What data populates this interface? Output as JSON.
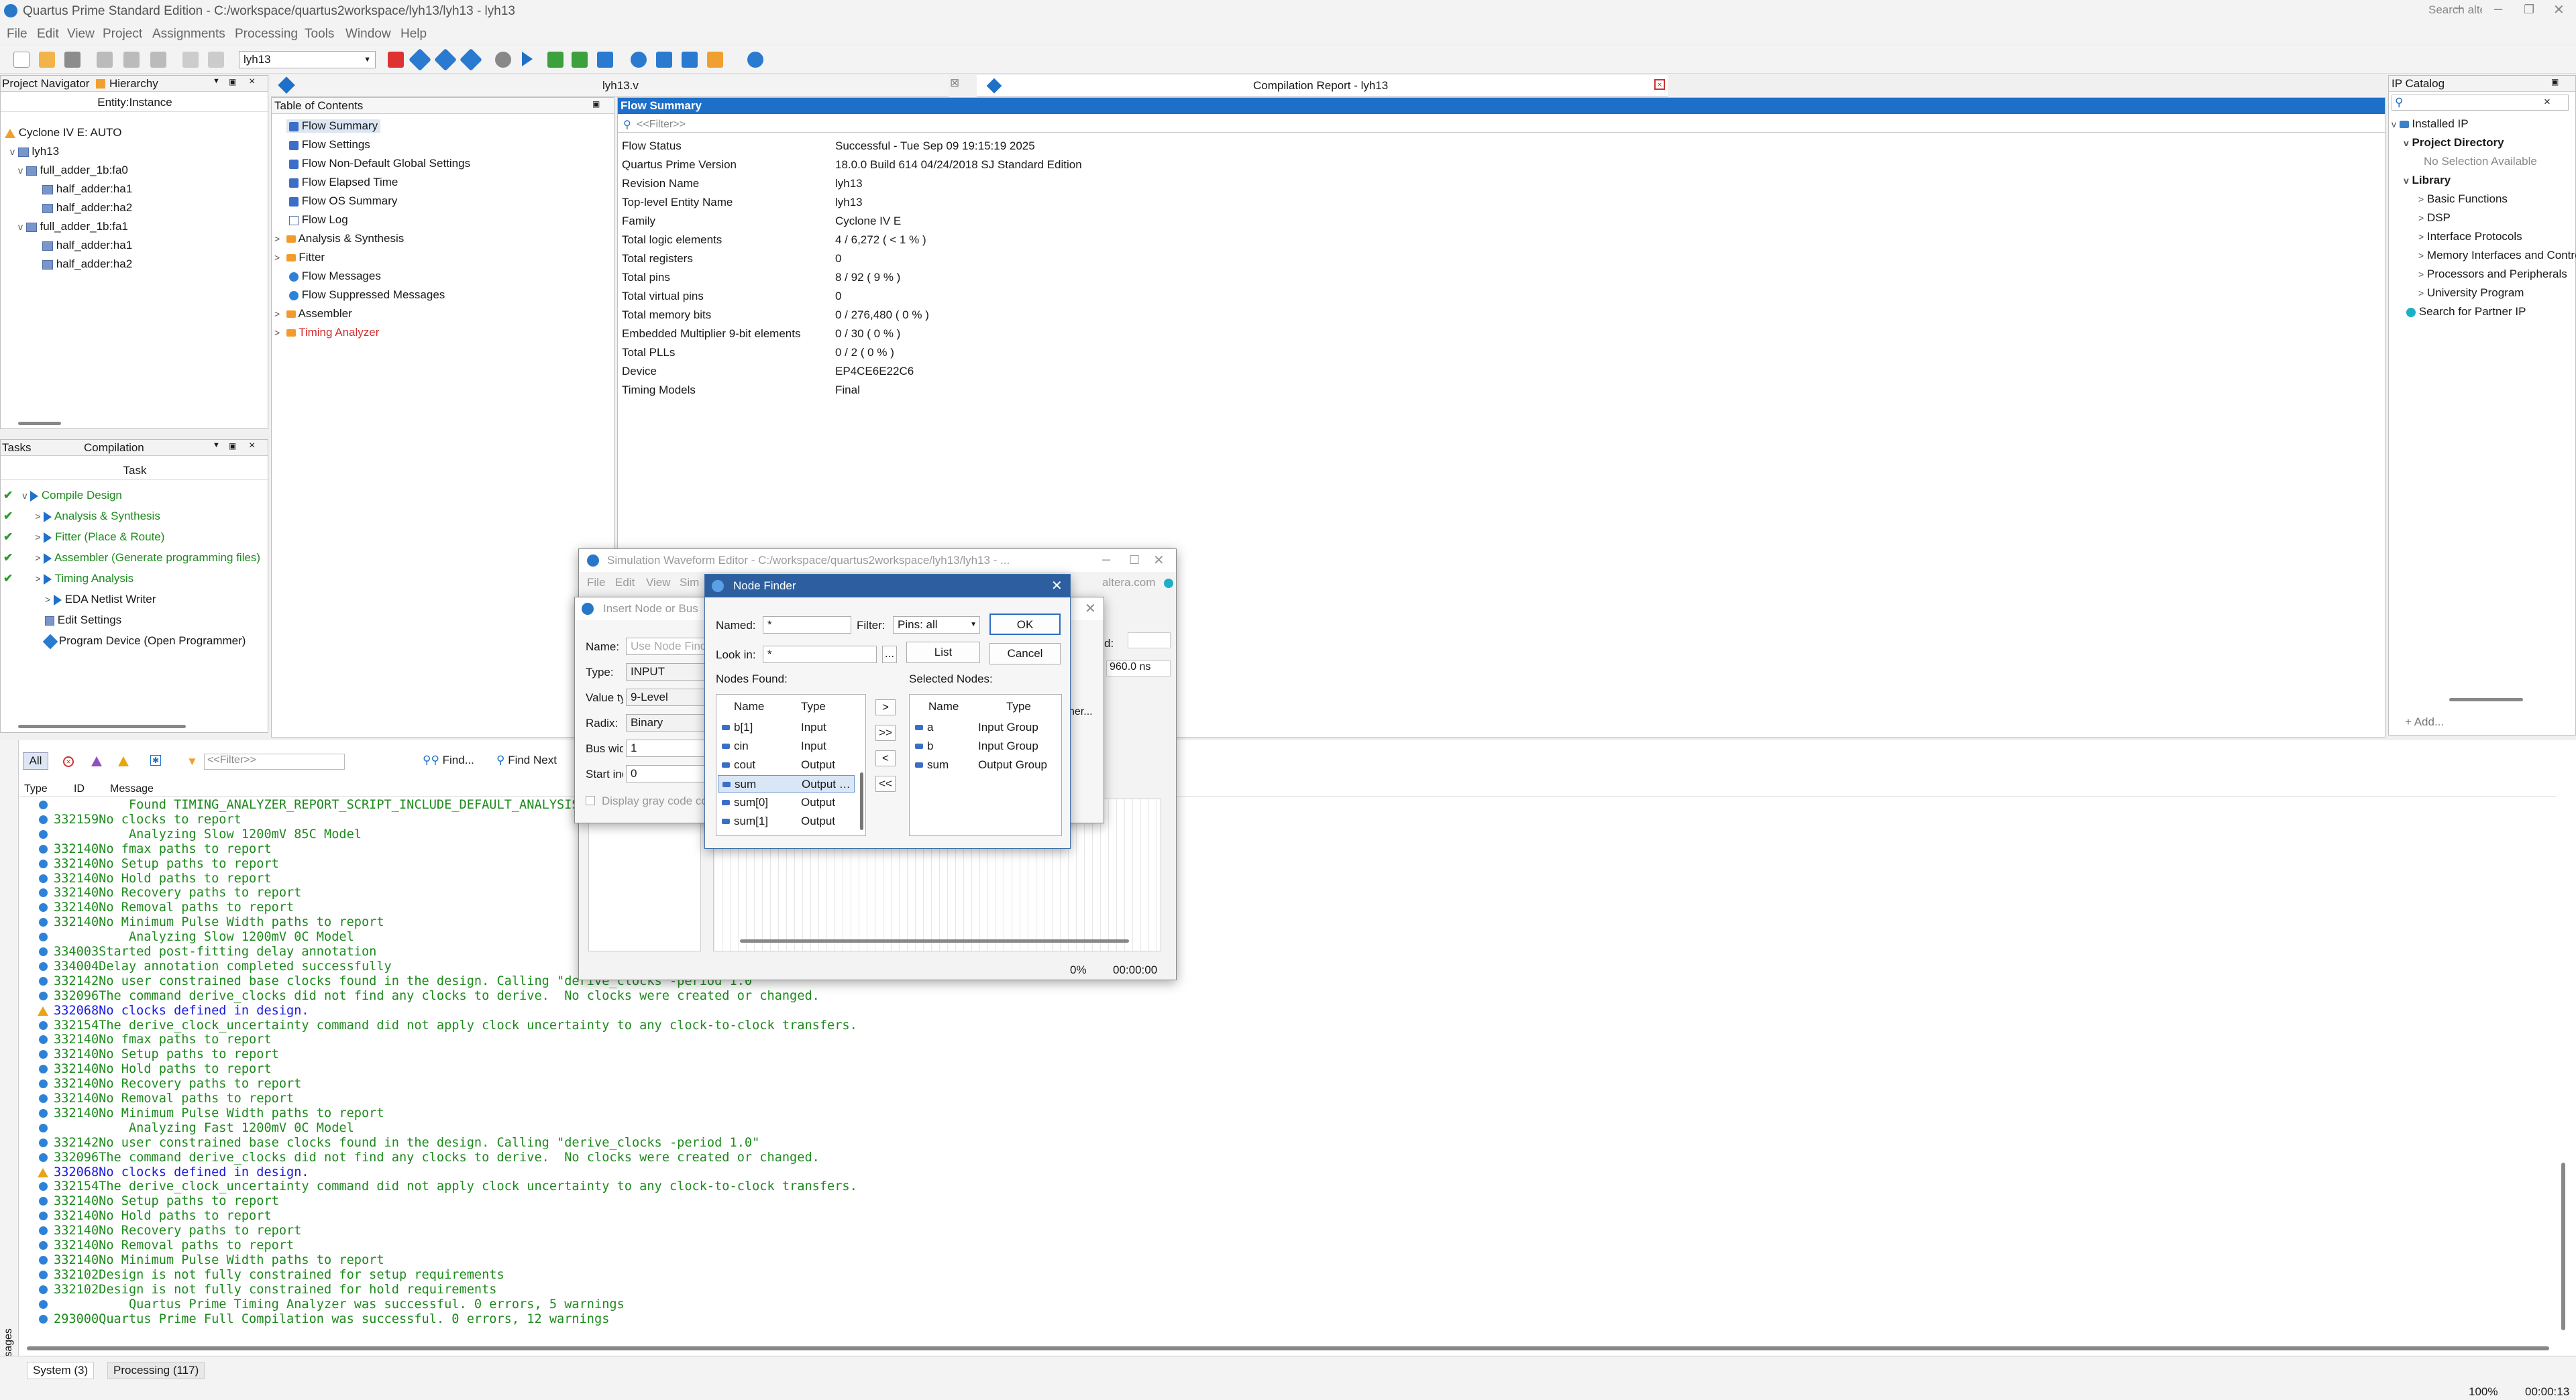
{
  "app": {
    "title": "Quartus Prime Standard Edition - C:/workspace/quartus2workspace/lyh13/lyh13 - lyh13",
    "search_placeholder": "Search altera.com"
  },
  "menu": [
    "File",
    "Edit",
    "View",
    "Project",
    "Assignments",
    "Processing",
    "Tools",
    "Window",
    "Help"
  ],
  "toolbar": {
    "project_combo": "lyh13"
  },
  "project_navigator": {
    "title": "Project Navigator",
    "view": "Hierarchy",
    "column": "Entity:Instance",
    "items": [
      "Cyclone IV E: AUTO",
      "lyh13",
      "full_adder_1b:fa0",
      "half_adder:ha1",
      "half_adder:ha2",
      "full_adder_1b:fa1",
      "half_adder:ha1",
      "half_adder:ha2"
    ]
  },
  "tasks": {
    "title": "Tasks",
    "flow": "Compilation",
    "column": "Task",
    "items": [
      "Compile Design",
      "Analysis & Synthesis",
      "Fitter (Place & Route)",
      "Assembler (Generate programming files)",
      "Timing Analysis",
      "EDA Netlist Writer",
      "Edit Settings",
      "Program Device (Open Programmer)"
    ]
  },
  "tabs": {
    "verilog": "lyh13.v",
    "report": "Compilation Report - lyh13"
  },
  "toc": {
    "title": "Table of Contents",
    "items": [
      "Flow Summary",
      "Flow Settings",
      "Flow Non-Default Global Settings",
      "Flow Elapsed Time",
      "Flow OS Summary",
      "Flow Log",
      "Analysis & Synthesis",
      "Fitter",
      "Flow Messages",
      "Flow Suppressed Messages",
      "Assembler",
      "Timing Analyzer"
    ]
  },
  "flow_summary": {
    "title": "Flow Summary",
    "filter": "<<Filter>>",
    "rows": [
      [
        "Flow Status",
        "Successful - Tue Sep 09 19:15:19 2025"
      ],
      [
        "Quartus Prime Version",
        "18.0.0 Build 614 04/24/2018 SJ Standard Edition"
      ],
      [
        "Revision Name",
        "lyh13"
      ],
      [
        "Top-level Entity Name",
        "lyh13"
      ],
      [
        "Family",
        "Cyclone IV E"
      ],
      [
        "Total logic elements",
        "4 / 6,272 ( < 1 % )"
      ],
      [
        "Total registers",
        "0"
      ],
      [
        "Total pins",
        "8 / 92 ( 9 % )"
      ],
      [
        "Total virtual pins",
        "0"
      ],
      [
        "Total memory bits",
        "0 / 276,480 ( 0 % )"
      ],
      [
        "Embedded Multiplier 9-bit elements",
        "0 / 30 ( 0 % )"
      ],
      [
        "Total PLLs",
        "0 / 2 ( 0 % )"
      ],
      [
        "Device",
        "EP4CE6E22C6"
      ],
      [
        "Timing Models",
        "Final"
      ]
    ]
  },
  "ip_catalog": {
    "title": "IP Catalog",
    "items": [
      "Installed IP",
      "Project Directory",
      "No Selection Available",
      "Library",
      "Basic Functions",
      "DSP",
      "Interface Protocols",
      "Memory Interfaces and Controllers",
      "Processors and Peripherals",
      "University Program",
      "Search for Partner IP"
    ],
    "add": "+ Add..."
  },
  "messages": {
    "all": "All",
    "filter": "<<Filter>>",
    "find": "Find...",
    "find_next": "Find Next",
    "cols": [
      "Type",
      "ID",
      "Message"
    ],
    "side_label": "Messages",
    "lines": [
      {
        "t": "i",
        "id": "",
        "m": "    Found TIMING_ANALYZER_REPORT_SCRIPT_INCLUDE_DEFAULT_ANALYSIS = ON"
      },
      {
        "t": "i",
        "id": "332159",
        "m": "No clocks to report"
      },
      {
        "t": "i",
        "id": "",
        "m": "    Analyzing Slow 1200mV 85C Model"
      },
      {
        "t": "i",
        "id": "332140",
        "m": "No fmax paths to report"
      },
      {
        "t": "i",
        "id": "332140",
        "m": "No Setup paths to report"
      },
      {
        "t": "i",
        "id": "332140",
        "m": "No Hold paths to report"
      },
      {
        "t": "i",
        "id": "332140",
        "m": "No Recovery paths to report"
      },
      {
        "t": "i",
        "id": "332140",
        "m": "No Removal paths to report"
      },
      {
        "t": "i",
        "id": "332140",
        "m": "No Minimum Pulse Width paths to report"
      },
      {
        "t": "i",
        "id": "",
        "m": "    Analyzing Slow 1200mV 0C Model"
      },
      {
        "t": "i",
        "id": "334003",
        "m": "Started post-fitting delay annotation"
      },
      {
        "t": "i",
        "id": "334004",
        "m": "Delay annotation completed successfully"
      },
      {
        "t": "i",
        "id": "332142",
        "m": "No user constrained base clocks found in the design. Calling \"derive_clocks -period 1.0\""
      },
      {
        "t": "i",
        "id": "332096",
        "m": "The command derive_clocks did not find any clocks to derive.  No clocks were created or changed."
      },
      {
        "t": "w",
        "id": "332068",
        "m": "No clocks defined in design."
      },
      {
        "t": "i",
        "id": "332154",
        "m": "The derive_clock_uncertainty command did not apply clock uncertainty to any clock-to-clock transfers."
      },
      {
        "t": "i",
        "id": "332140",
        "m": "No fmax paths to report"
      },
      {
        "t": "i",
        "id": "332140",
        "m": "No Setup paths to report"
      },
      {
        "t": "i",
        "id": "332140",
        "m": "No Hold paths to report"
      },
      {
        "t": "i",
        "id": "332140",
        "m": "No Recovery paths to report"
      },
      {
        "t": "i",
        "id": "332140",
        "m": "No Removal paths to report"
      },
      {
        "t": "i",
        "id": "332140",
        "m": "No Minimum Pulse Width paths to report"
      },
      {
        "t": "i",
        "id": "",
        "m": "    Analyzing Fast 1200mV 0C Model"
      },
      {
        "t": "i",
        "id": "332142",
        "m": "No user constrained base clocks found in the design. Calling \"derive_clocks -period 1.0\""
      },
      {
        "t": "i",
        "id": "332096",
        "m": "The command derive_clocks did not find any clocks to derive.  No clocks were created or changed."
      },
      {
        "t": "w",
        "id": "332068",
        "m": "No clocks defined in design."
      },
      {
        "t": "i",
        "id": "332154",
        "m": "The derive_clock_uncertainty command did not apply clock uncertainty to any clock-to-clock transfers."
      },
      {
        "t": "i",
        "id": "332140",
        "m": "No Setup paths to report"
      },
      {
        "t": "i",
        "id": "332140",
        "m": "No Hold paths to report"
      },
      {
        "t": "i",
        "id": "332140",
        "m": "No Recovery paths to report"
      },
      {
        "t": "i",
        "id": "332140",
        "m": "No Removal paths to report"
      },
      {
        "t": "i",
        "id": "332140",
        "m": "No Minimum Pulse Width paths to report"
      },
      {
        "t": "i",
        "id": "332102",
        "m": "Design is not fully constrained for setup requirements"
      },
      {
        "t": "i",
        "id": "332102",
        "m": "Design is not fully constrained for hold requirements"
      },
      {
        "t": "i",
        "id": "",
        "m": "    Quartus Prime Timing Analyzer was successful. 0 errors, 5 warnings"
      },
      {
        "t": "i",
        "id": "293000",
        "m": "Quartus Prime Full Compilation was successful. 0 errors, 12 warnings"
      }
    ],
    "bottom_tabs": [
      "System (3)",
      "Processing (117)"
    ]
  },
  "status": {
    "zoom": "100%",
    "time": "00:00:13"
  },
  "sim_editor": {
    "title": "Simulation Waveform Editor - C:/workspace/quartus2workspace/lyh13/lyh13 - ...",
    "menu": [
      "File",
      "Edit",
      "View",
      "Sim"
    ],
    "right_text": "altera.com",
    "end_time": "960.0 ns",
    "percent": "0%",
    "timer": "00:00:00"
  },
  "insert_node": {
    "title": "Insert Node or Bus",
    "name_label": "Name:",
    "name_placeholder": "Use Node Finder",
    "type_label": "Type:",
    "type_value": "INPUT",
    "value_label": "Value type:",
    "value_value": "9-Level",
    "radix_label": "Radix:",
    "radix_value": "Binary",
    "bus_label": "Bus width:",
    "bus_value": "1",
    "start_label": "Start index:",
    "start_value": "0",
    "gray": "Display gray code count as binary count",
    "d_label": "d:",
    "ner": "ner..."
  },
  "node_finder": {
    "title": "Node Finder",
    "named_label": "Named:",
    "named_value": "*",
    "filter_label": "Filter:",
    "filter_value": "Pins: all",
    "lookin_label": "Look in:",
    "lookin_value": "*",
    "dots": "...",
    "ok": "OK",
    "list": "List",
    "cancel": "Cancel",
    "found_label": "Nodes Found:",
    "selected_label": "Selected Nodes:",
    "col_name": "Name",
    "col_type": "Type",
    "found": [
      [
        "b[1]",
        "Input"
      ],
      [
        "cin",
        "Input"
      ],
      [
        "cout",
        "Output"
      ],
      [
        "sum",
        "Output Group"
      ],
      [
        "sum[0]",
        "Output"
      ],
      [
        "sum[1]",
        "Output"
      ]
    ],
    "selected": [
      [
        "a",
        "Input Group"
      ],
      [
        "b",
        "Input Group"
      ],
      [
        "sum",
        "Output Group"
      ]
    ],
    "arrows": [
      ">",
      ">>",
      "<",
      "<<"
    ]
  }
}
